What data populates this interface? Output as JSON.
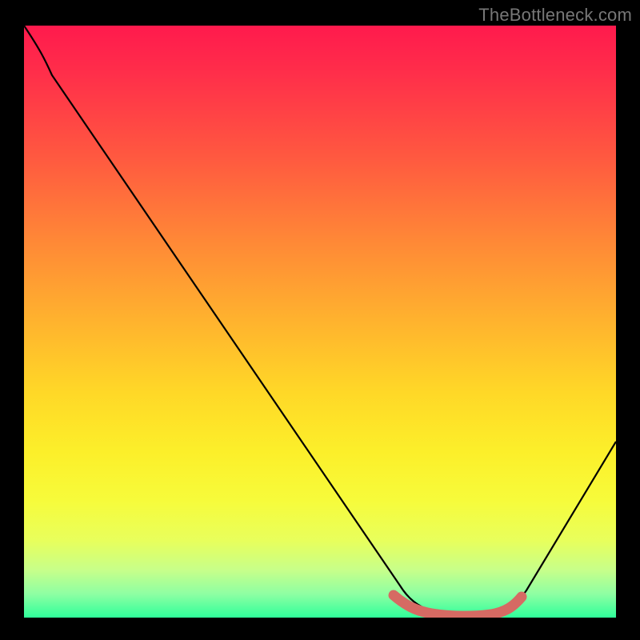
{
  "watermark": "TheBottleneck.com",
  "chart_data": {
    "type": "line",
    "title": "",
    "xlabel": "",
    "ylabel": "",
    "ylim": [
      0,
      100
    ],
    "xlim": [
      0,
      100
    ],
    "series": [
      {
        "name": "bottleneck-curve",
        "x": [
          0,
          4,
          10,
          20,
          30,
          40,
          50,
          58,
          62,
          66,
          70,
          74,
          78,
          82,
          88,
          94,
          100
        ],
        "y": [
          100,
          96,
          90,
          77,
          64,
          51,
          38,
          24,
          14,
          6,
          2,
          0,
          0,
          2,
          8,
          18,
          30
        ]
      }
    ],
    "highlight": {
      "name": "optimal-range",
      "x": [
        62,
        66,
        70,
        74,
        78,
        82
      ],
      "y": [
        4,
        2,
        1,
        1,
        2,
        4
      ],
      "color": "#d66a63"
    },
    "gradient_stops": [
      {
        "pos": 0,
        "color": "#ff1a4d"
      },
      {
        "pos": 50,
        "color": "#ffb32e"
      },
      {
        "pos": 80,
        "color": "#f7fb3a"
      },
      {
        "pos": 100,
        "color": "#2fff9a"
      }
    ]
  }
}
